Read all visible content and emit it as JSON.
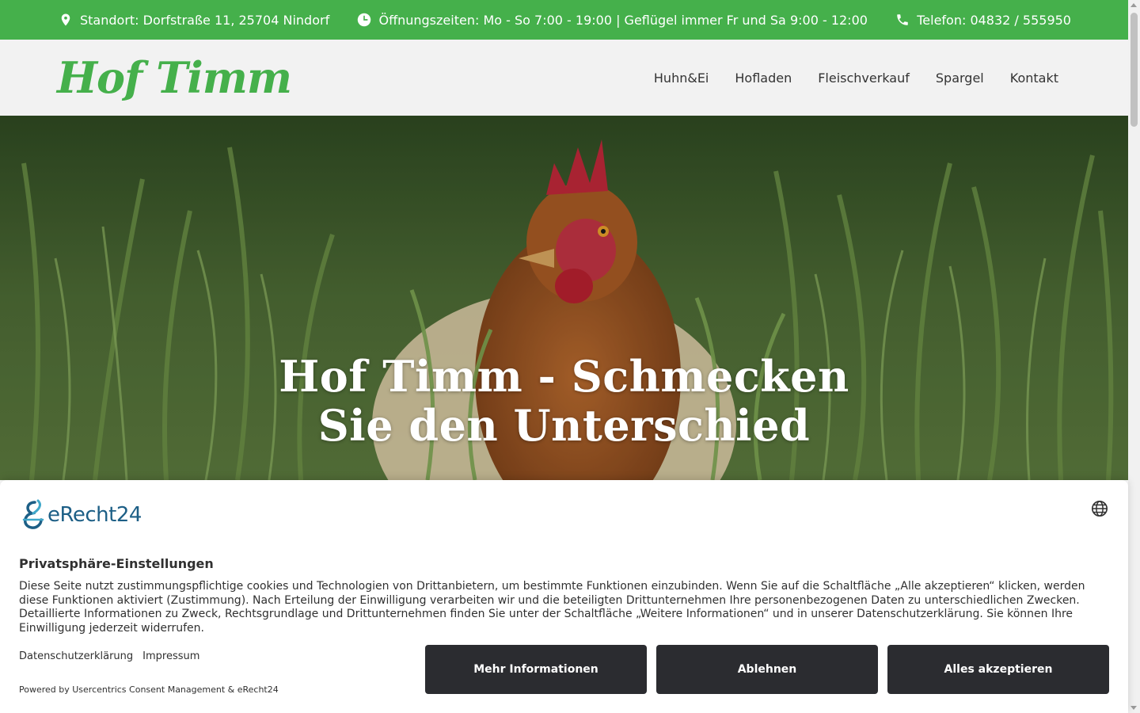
{
  "topbar": {
    "location": "Standort: Dorfstraße 11, 25704 Nindorf",
    "hours": "Öffnungszeiten: Mo - So 7:00 - 19:00 | Geflügel immer Fr und Sa 9:00 - 12:00",
    "phone": "Telefon: 04832 / 555950",
    "icons": [
      "location-pin-icon",
      "clock-icon",
      "phone-icon"
    ]
  },
  "header": {
    "logo": "Hof Timm",
    "nav": [
      "Huhn&Ei",
      "Hofladen",
      "Fleischverkauf",
      "Spargel",
      "Kontakt"
    ]
  },
  "hero": {
    "title_line1": "Hof Timm - Schmecken",
    "title_line2": "Sie den Unterschied"
  },
  "consent": {
    "brand": "eRecht24",
    "title": "Privatsphäre-Einstellungen",
    "text": "Diese Seite nutzt zustimmungspflichtige cookies und Technologien von Drittanbietern, um bestimmte Funktionen einzubinden. Wenn Sie auf die Schaltfläche „Alle akzeptieren“ klicken, werden diese Funktionen aktiviert (Zustimmung). Nach Erteilung der Einwilligung verarbeiten wir und die beteiligten Drittunternehmen Ihre personenbezogenen Daten zu unterschiedlichen Zwecken. Detaillierte Informationen zu Zweck, Rechtsgrundlage und Drittunternehmen finden Sie unter der Schaltfläche „Weitere Informationen“ und in unserer Datenschutzerklärung. Sie können Ihre Einwilligung jederzeit widerrufen.",
    "links": [
      "Datenschutzerklärung",
      "Impressum"
    ],
    "powered": "Powered by Usercentrics Consent Management & eRecht24",
    "buttons": [
      "Mehr Informationen",
      "Ablehnen",
      "Alles akzeptieren"
    ]
  },
  "colors": {
    "brand_green": "#45b04b",
    "header_bg": "#f2f2f2",
    "button_bg": "#2b2c30",
    "erecht_blue": "#1d5f86"
  }
}
